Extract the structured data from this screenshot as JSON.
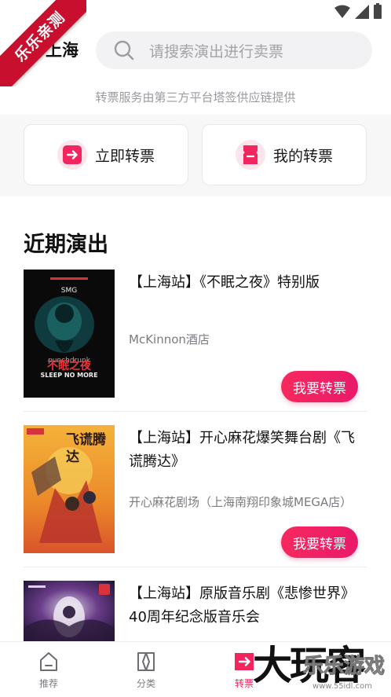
{
  "ribbon": {
    "text": "乐乐亲测"
  },
  "header": {
    "city": "上海",
    "search_placeholder": "请搜索演出进行卖票"
  },
  "provider_note": "转票服务由第三方平台塔签供应链提供",
  "actions": [
    {
      "label": "立即转票",
      "icon": "transfer-arrow-icon"
    },
    {
      "label": "我的转票",
      "icon": "ticket-icon"
    }
  ],
  "section_title": "近期演出",
  "shows": [
    {
      "title": "【上海站】《不眠之夜》特别版",
      "venue": "McKinnon酒店",
      "button": "我要转票",
      "poster": {
        "top_text": "SMG",
        "title_cn": "不眠之夜",
        "title_en": "SLEEP NO MORE"
      }
    },
    {
      "title": "【上海站】开心麻花爆笑舞台剧《飞谎腾达》",
      "venue": "开心麻花剧场（上海南翔印象城MEGA店）",
      "button": "我要转票",
      "poster": {
        "title_cn": "飞谎腾达"
      }
    },
    {
      "title": "【上海站】原版音乐剧《悲惨世界》40周年纪念版音乐会",
      "venue": "",
      "button": "",
      "poster": {}
    }
  ],
  "bottom_nav": [
    {
      "label": "推荐",
      "icon": "home-icon",
      "active": false
    },
    {
      "label": "分类",
      "icon": "category-icon",
      "active": false
    },
    {
      "label": "转票",
      "icon": "transfer-arrow-icon",
      "active": true
    }
  ],
  "watermark": {
    "big": "大玩客",
    "small": "乐乐游戏",
    "url": "www.55idl.com"
  },
  "colors": {
    "accent": "#f2255f",
    "accent_light": "#fde3ea",
    "text": "#1a1a1a",
    "muted": "#9a9aa0"
  }
}
